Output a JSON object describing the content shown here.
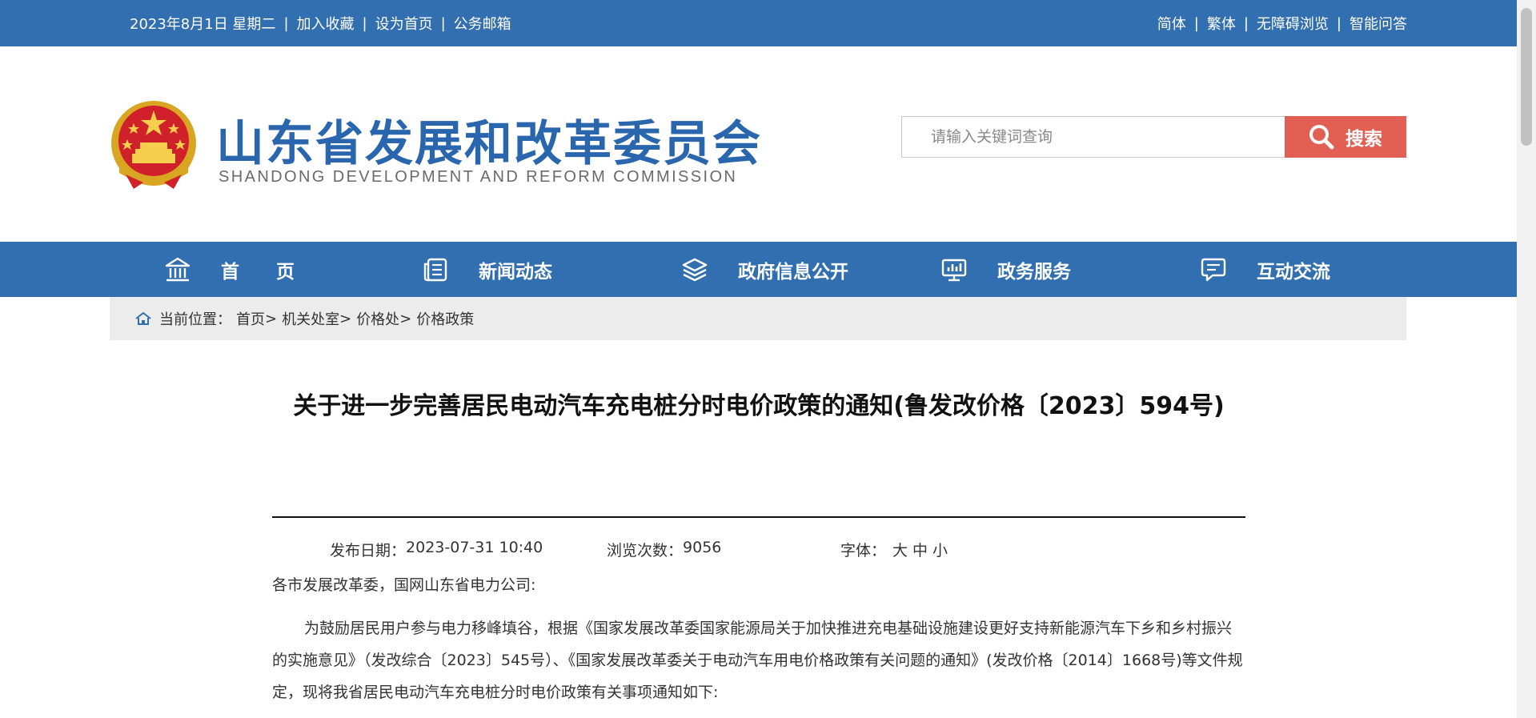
{
  "topbar": {
    "date": "2023年8月1日 星期二",
    "sep": "|",
    "left_links": [
      "加入收藏",
      "设为首页",
      "公务邮箱"
    ],
    "right_links": [
      "简体",
      "繁体",
      "无障碍浏览",
      "智能问答"
    ]
  },
  "header": {
    "title": "山东省发展和改革委员会",
    "subtitle": "SHANDONG DEVELOPMENT AND REFORM COMMISSION",
    "search_placeholder": "请输入关键词查询",
    "search_button": "搜索"
  },
  "nav": {
    "items": [
      {
        "label": "首页",
        "icon": "bank-icon"
      },
      {
        "label": "新闻动态",
        "icon": "news-icon"
      },
      {
        "label": "政府信息公开",
        "icon": "layers-icon"
      },
      {
        "label": "政务服务",
        "icon": "monitor-chart-icon"
      },
      {
        "label": "互动交流",
        "icon": "chat-icon"
      }
    ]
  },
  "breadcrumb": {
    "prefix": "当前位置：",
    "items": [
      "首页",
      "机关处室",
      "价格处",
      "价格政策"
    ],
    "sep": ">"
  },
  "article": {
    "title": "关于进一步完善居民电动汽车充电桩分时电价政策的通知(鲁发改价格〔2023〕594号)",
    "publish_label": "发布日期：",
    "publish_value": "2023-07-31 10:40",
    "views_label": "浏览次数：",
    "views_value": "9056",
    "font_label": "字体：",
    "font_sizes": [
      "大",
      "中",
      "小"
    ],
    "salutation": "各市发展改革委，国网山东省电力公司:",
    "paragraph": "为鼓励居民用户参与电力移峰填谷，根据《国家发展改革委国家能源局关于加快推进充电基础设施建设更好支持新能源汽车下乡和乡村振兴的实施意见》（发改综合〔2023〕545号）、《国家发展改革委关于电动汽车用电价格政策有关问题的通知》(发改价格〔2014〕1668号)等文件规定，现将我省居民电动汽车充电桩分时电价政策有关事项通知如下:"
  },
  "colors": {
    "brand_blue": "#326fb0",
    "search_red": "#e15f53",
    "breadcrumb_bg": "#ececec"
  }
}
